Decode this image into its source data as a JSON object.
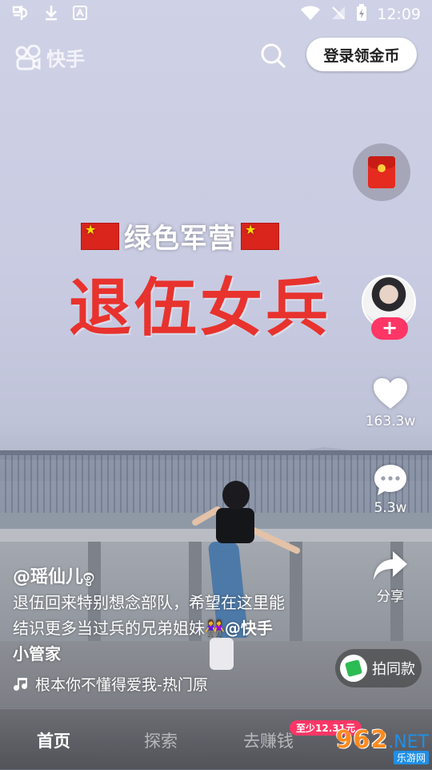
{
  "status_bar": {
    "left_icons": [
      "app-icon",
      "download-icon",
      "notification-icon"
    ],
    "time": "12:09"
  },
  "header": {
    "logo_text": "快手",
    "login_label": "登录领金币"
  },
  "video_overlay": {
    "top_line": "绿色军营",
    "main_title": "退伍女兵"
  },
  "rail": {
    "like_count": "163.3w",
    "comment_count": "5.3w",
    "share_label": "分享",
    "follow_symbol": "+"
  },
  "caption": {
    "author": "@瑶仙儿ඉ",
    "desc_line1": "退伍回来特别想念部队，希望在这里能",
    "desc_line2_text": "结识更多当过兵的兄弟姐妹👭",
    "desc_mention": "@快手",
    "desc_line3": "小管家",
    "music": "根本你不懂得爱我-热门原"
  },
  "same_style": {
    "label": "拍同款"
  },
  "bottom_nav": {
    "items": [
      {
        "label": "首页"
      },
      {
        "label": "探索"
      },
      {
        "label": "去赚钱"
      }
    ],
    "earn_badge": "至少12.31元"
  },
  "watermark": {
    "number": "962",
    "suffix": ".NET",
    "sub": "乐游网"
  },
  "colors": {
    "like_accent": "#fe3666",
    "overlay_red": "#e8322d",
    "badge_pink": "#fe3666"
  }
}
